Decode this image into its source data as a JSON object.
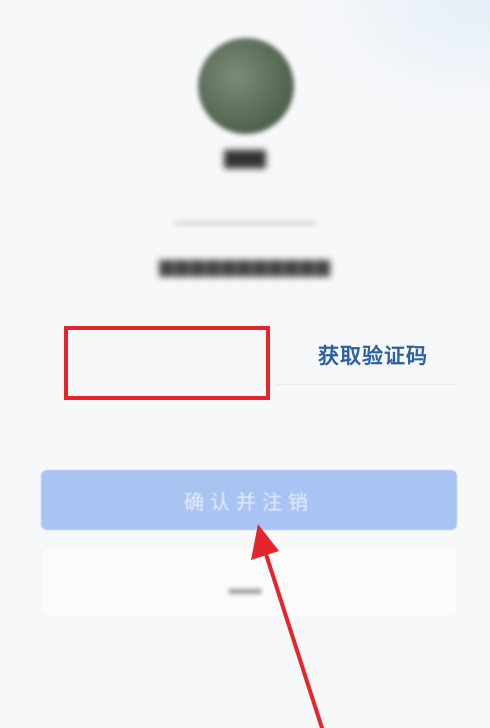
{
  "verification": {
    "code_input_value": "",
    "get_code_label": "获取验证码"
  },
  "actions": {
    "confirm_cancel_label": "确认并注销"
  },
  "colors": {
    "accent": "#2d5fa3",
    "button_bg": "#a9c3f3",
    "annotation_red": "#e4262c"
  }
}
